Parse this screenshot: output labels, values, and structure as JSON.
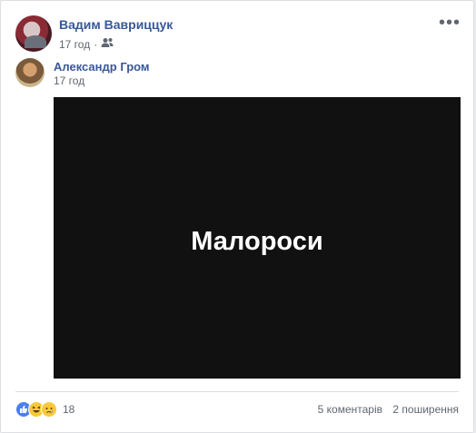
{
  "post": {
    "author": "Вадим Вавриццук",
    "time": "17 год",
    "separator": "·",
    "audience_icon": "friends-icon",
    "more_icon": "more-options-icon"
  },
  "shared": {
    "author": "Александр Гром",
    "time": "17 год",
    "image_text": "Малороси",
    "image_background": "#111111"
  },
  "footer": {
    "reaction_icons": [
      "like-icon",
      "haha-icon",
      "sad-icon"
    ],
    "reaction_count": "18",
    "comments": "5 коментарів",
    "shares": "2 поширення"
  },
  "colors": {
    "link": "#385898",
    "meta": "#616770",
    "like": "#4a7ff2",
    "emoji": "#f7c93b"
  }
}
